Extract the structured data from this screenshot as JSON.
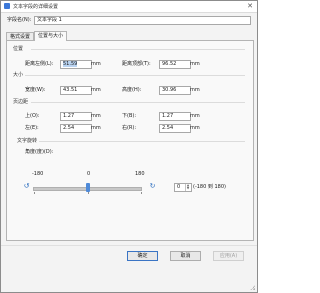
{
  "window": {
    "title": "文本字段的详细设置"
  },
  "field_name": {
    "label": "字段名(N):",
    "value": "文本字段 1"
  },
  "tabs": [
    {
      "label": "格式设置",
      "active": false
    },
    {
      "label": "位置与大小",
      "active": true
    }
  ],
  "position": {
    "heading": "位置",
    "left_label": "距离左侧(L):",
    "left_value": "51.59",
    "left_unit": "mm",
    "top_label": "距离顶部(T):",
    "top_value": "96.52",
    "top_unit": "mm"
  },
  "size": {
    "heading": "大小",
    "width_label": "宽度(W):",
    "width_value": "43.51",
    "width_unit": "mm",
    "height_label": "高度(H):",
    "height_value": "30.96",
    "height_unit": "mm"
  },
  "margins": {
    "heading": "页边距",
    "top_label": "上(O):",
    "top_value": "1.27",
    "top_unit": "mm",
    "bottom_label": "下(B):",
    "bottom_value": "1.27",
    "bottom_unit": "mm",
    "left_label": "左(E):",
    "left_value": "2.54",
    "left_unit": "mm",
    "right_label": "右(R):",
    "right_value": "2.54",
    "right_unit": "mm"
  },
  "rotation": {
    "heading": "文字旋转",
    "angle_label": "角度(度)(D):",
    "min_label": "-180",
    "mid_label": "0",
    "max_label": "180",
    "slider_value": 0,
    "angle_value": "0",
    "range_hint": "(-180 到 180)"
  },
  "buttons": {
    "ok": "确定",
    "cancel": "取消",
    "apply": "应用(A)"
  },
  "colors": {
    "accent": "#3c78d8",
    "selection": "#b9d3f1"
  }
}
